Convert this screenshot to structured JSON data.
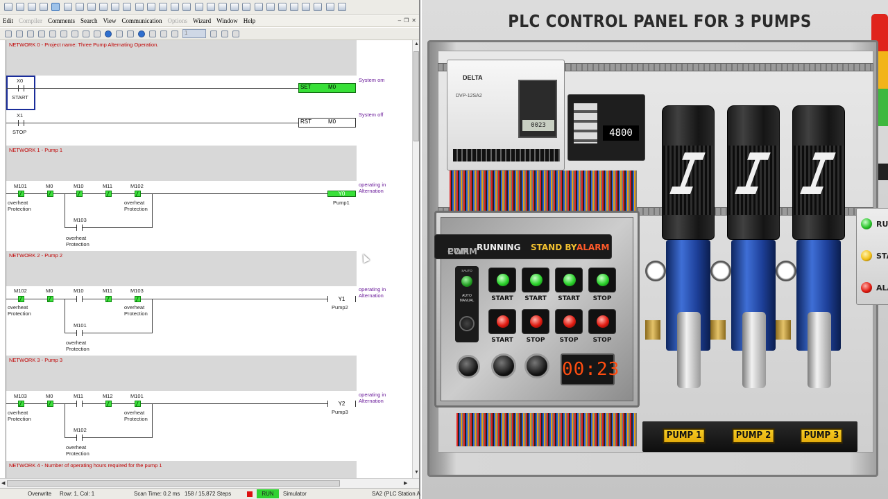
{
  "app": {
    "menu": [
      "Edit",
      "Compiler",
      "Comments",
      "Search",
      "View",
      "Communication",
      "Options",
      "Wizard",
      "Window",
      "Help"
    ],
    "dim_menu": [
      "Compiler",
      "Options"
    ],
    "step_value": "1"
  },
  "ladder": {
    "networks": [
      {
        "label": "NETWORK 0 - Project name: Three Pump Alternating Operation."
      },
      {
        "label": "NETWORK 1 - Pump 1"
      },
      {
        "label": "NETWORK 2 - Pump 2"
      },
      {
        "label": "NETWORK 3 - Pump 3"
      },
      {
        "label": "NETWORK 4 - Number of operating hours required for the pump 1"
      }
    ],
    "net0": {
      "x0": "X0",
      "start": "START",
      "set": "SET",
      "m0_1": "M0",
      "sys_on": "System om",
      "x1": "X1",
      "stop": "STOP",
      "rst": "RST",
      "m0_2": "M0",
      "sys_off": "System off"
    },
    "net1": {
      "c1": "M101",
      "c2": "M0",
      "c3": "M10",
      "c4": "M11",
      "c5": "M102",
      "c6": "M103",
      "coil": "Y0",
      "coil_label": "Pump1",
      "ann1": "operating in",
      "ann2": "Alternation"
    },
    "net2": {
      "c1": "M102",
      "c2": "M0",
      "c3": "M10",
      "c4": "M11",
      "c5": "M103",
      "c6": "M101",
      "coil": "Y1",
      "coil_label": "Pump2",
      "ann1": "operating in",
      "ann2": "Alternation"
    },
    "net3": {
      "c1": "M103",
      "c2": "M0",
      "c3": "M11",
      "c4": "M12",
      "c5": "M101",
      "c6": "M102",
      "coil": "Y2",
      "coil_label": "Pump3",
      "ann1": "operating in",
      "ann2": "Alternation"
    },
    "oh1": "overheat",
    "oh2": "Protection"
  },
  "status": {
    "mode": "Overwrite",
    "position": "Row: 1, Col: 1",
    "scan": "Scan Time: 0.2 ms",
    "steps": "158 / 15,872 Steps",
    "run": "RUN",
    "sim": "Simulator",
    "station": "SA2 (PLC Station A"
  },
  "panel": {
    "title": "PLC CONTROL PANEL FOR 3 PUMPS",
    "plc_brand": "DELTA",
    "plc_model": "DVP-12SA2",
    "plc_lcd": "0023",
    "io_display": "4800",
    "strip_running": "RUNNING",
    "strip_standby": "STAND BY",
    "strip_alarm": "ALARM",
    "strip_mini1": "PWR",
    "strip_mini2": "COMM",
    "selector_title": "SAUTO",
    "selector_auto": "AUTO",
    "selector_manual": "MANUAL",
    "green_labels": [
      "START",
      "START",
      "START",
      "STOP"
    ],
    "red_labels": [
      "START",
      "STOP",
      "STOP",
      "STOP"
    ],
    "timer": "00:23",
    "pump_plates": [
      "PUMP 1",
      "PUMP 2",
      "PUMP 3"
    ],
    "side_labels": [
      "RUNN",
      "STAN",
      "ALAR"
    ],
    "tower_colors": [
      "#e0241c",
      "#f2b41a",
      "#3fb83f",
      "#d8d8d8"
    ]
  }
}
